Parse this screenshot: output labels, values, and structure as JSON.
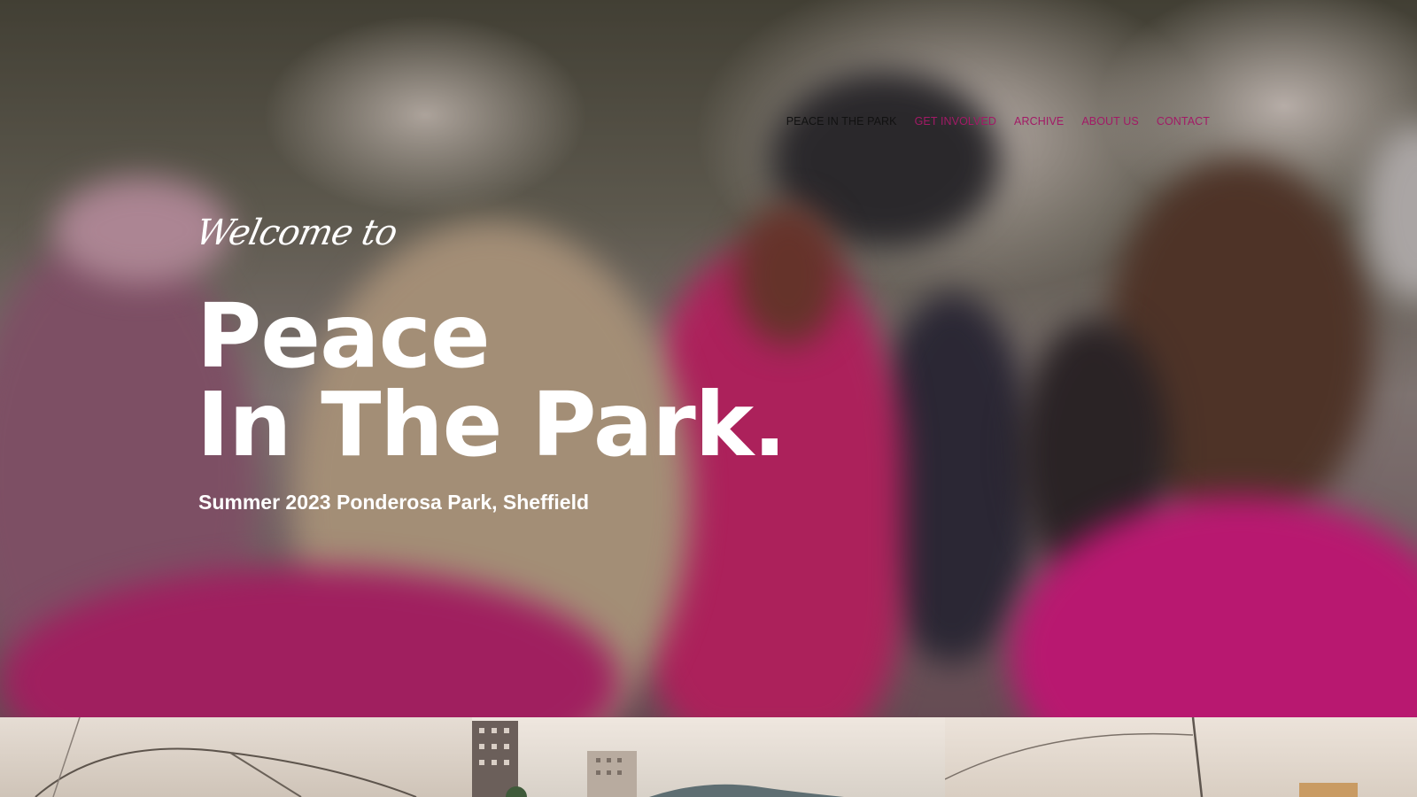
{
  "nav": {
    "items": [
      {
        "label": "PEACE IN THE PARK",
        "active": true
      },
      {
        "label": "GET INVOLVED",
        "active": false
      },
      {
        "label": "ARCHIVE",
        "active": false
      },
      {
        "label": "ABOUT US",
        "active": false
      },
      {
        "label": "CONTACT",
        "active": false
      }
    ]
  },
  "hero": {
    "welcome": "Welcome to",
    "title_line1": "Peace",
    "title_line2": "In The Park.",
    "subtitle": "Summer 2023 Ponderosa Park, Sheffield"
  },
  "colors": {
    "nav_link": "#a21a66",
    "nav_active": "#111111",
    "hero_text": "#ffffff"
  }
}
